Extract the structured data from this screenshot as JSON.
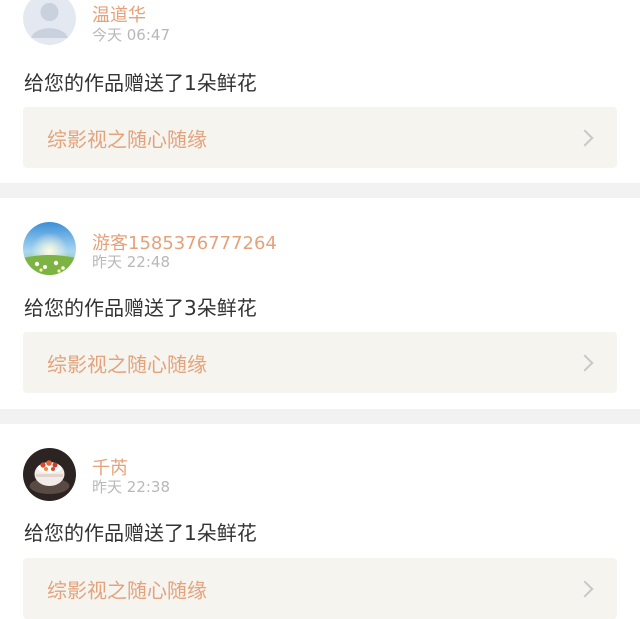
{
  "colors": {
    "accent": "#e5a27a",
    "text": "#333333",
    "muted": "#b8b8b8",
    "link_background": "#f5f4ee",
    "separator": "#f2f2f2"
  },
  "notifications": [
    {
      "user_name": "温道华",
      "time": "今天 06:47",
      "message": "给您的作品赠送了1朵鲜花",
      "work_title": "综影视之随心随缘",
      "avatar_icon": "default-user-avatar-icon",
      "chevron_icon": "chevron-right-icon"
    },
    {
      "user_name": "游客1585376777264",
      "time": "昨天 22:48",
      "message": "给您的作品赠送了3朵鲜花",
      "work_title": "综影视之随心随缘",
      "avatar_icon": "landscape-photo-avatar-icon",
      "chevron_icon": "chevron-right-icon"
    },
    {
      "user_name": "千芮",
      "time": "昨天 22:38",
      "message": "给您的作品赠送了1朵鲜花",
      "work_title": "综影视之随心随缘",
      "avatar_icon": "cake-photo-avatar-icon",
      "chevron_icon": "chevron-right-icon"
    }
  ]
}
